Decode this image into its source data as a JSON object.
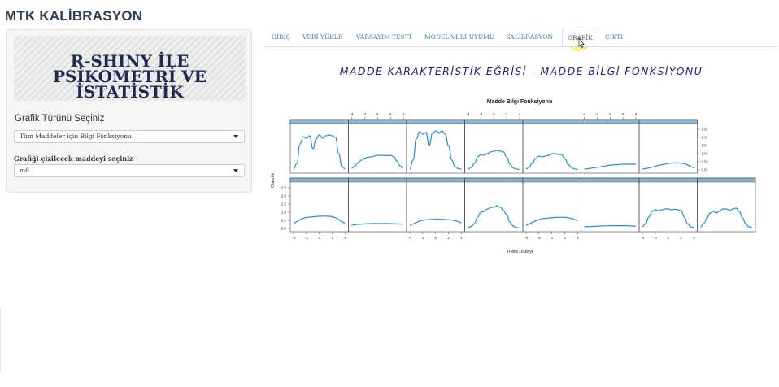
{
  "app": {
    "title": "MTK KALİBRASYON"
  },
  "sidebar": {
    "banner_lines": [
      "R-SHINY İLE PSİKOMETRİ VE",
      "İSTATİSTİK UYGULAMALARI"
    ],
    "chart_type_label": "Grafik Türünü Seçiniz",
    "chart_type_value": "Tüm Maddeler için Bilgi Fonksiyonu",
    "item_label": "Grafiği çizilecek maddeyi seçiniz",
    "item_value": "m6"
  },
  "tabs": [
    {
      "label": "GİRİŞ",
      "active": false
    },
    {
      "label": "VERİ YÜKLE",
      "active": false
    },
    {
      "label": "VARSAYIM TESTİ",
      "active": false
    },
    {
      "label": "MODEL VERİ UYUMU",
      "active": false
    },
    {
      "label": "KALİBRASYON",
      "active": false
    },
    {
      "label": "GRAFİK",
      "active": true
    },
    {
      "label": "ÇIKTI",
      "active": false
    }
  ],
  "main": {
    "heading": "MADDE KARAKTERİSTİK EĞRİSİ - MADDE BİLGİ FONKSİYONU"
  },
  "colors": {
    "curve": "#1f8fd6",
    "strip": "#8db6d6",
    "title": "#2c3e50",
    "heading": "#1c1e86"
  },
  "chart_data": {
    "type": "line",
    "title": "Madde Bilgi Fonksiyonu",
    "xlabel": "Theta Düzeyi",
    "ylabel": "Olasılık",
    "xlim": [
      -4,
      4
    ],
    "ylim": [
      0,
      2.7
    ],
    "xticks": [
      -4,
      -2,
      0,
      2,
      4
    ],
    "yticks": [
      0.0,
      0.5,
      1.0,
      1.5,
      2.0,
      2.5
    ],
    "x": [
      -4,
      -3.5,
      -3,
      -2.5,
      -2,
      -1.5,
      -1,
      -0.5,
      0,
      0.5,
      1,
      1.5,
      2,
      2.5,
      3,
      3.5,
      4
    ],
    "panels": [
      {
        "values": [
          0.05,
          0.4,
          1.6,
          2.05,
          1.95,
          2.1,
          1.3,
          1.9,
          2.15,
          1.95,
          2.1,
          2.15,
          2.1,
          2.0,
          1.0,
          0.2,
          0.05
        ]
      },
      {
        "values": [
          0.1,
          0.25,
          0.45,
          0.6,
          0.72,
          0.78,
          0.8,
          0.85,
          0.9,
          0.9,
          0.88,
          0.88,
          0.9,
          0.82,
          0.55,
          0.25,
          0.1
        ]
      },
      {
        "values": [
          0.05,
          0.6,
          1.9,
          2.35,
          2.2,
          2.3,
          1.5,
          2.25,
          2.4,
          2.3,
          2.4,
          2.2,
          1.5,
          0.6,
          0.2,
          0.08,
          0.05
        ]
      },
      {
        "values": [
          0.05,
          0.15,
          0.4,
          0.8,
          0.95,
          0.9,
          1.0,
          1.1,
          1.15,
          1.2,
          1.15,
          1.1,
          0.8,
          0.35,
          0.12,
          0.05,
          0.03
        ]
      },
      {
        "values": [
          0.05,
          0.2,
          0.45,
          0.7,
          0.85,
          0.8,
          0.85,
          0.9,
          1.0,
          1.0,
          0.95,
          0.95,
          0.7,
          0.35,
          0.15,
          0.06,
          0.03
        ]
      },
      {
        "values": [
          0.05,
          0.07,
          0.1,
          0.13,
          0.16,
          0.19,
          0.22,
          0.26,
          0.29,
          0.31,
          0.33,
          0.34,
          0.35,
          0.35,
          0.35,
          0.35,
          0.35
        ]
      },
      {
        "values": [
          0.05,
          0.08,
          0.12,
          0.17,
          0.22,
          0.27,
          0.32,
          0.36,
          0.4,
          0.42,
          0.43,
          0.43,
          0.42,
          0.38,
          0.3,
          0.2,
          0.12
        ]
      },
      {
        "values": [
          0.3,
          0.42,
          0.55,
          0.63,
          0.68,
          0.7,
          0.72,
          0.74,
          0.75,
          0.76,
          0.76,
          0.75,
          0.73,
          0.66,
          0.55,
          0.42,
          0.3
        ]
      },
      {
        "values": [
          0.2,
          0.23,
          0.25,
          0.27,
          0.28,
          0.29,
          0.3,
          0.3,
          0.3,
          0.3,
          0.3,
          0.3,
          0.3,
          0.29,
          0.28,
          0.27,
          0.26
        ]
      },
      {
        "values": [
          0.2,
          0.28,
          0.37,
          0.45,
          0.5,
          0.53,
          0.55,
          0.56,
          0.57,
          0.57,
          0.56,
          0.55,
          0.54,
          0.52,
          0.48,
          0.42,
          0.35
        ]
      },
      {
        "values": [
          0.05,
          0.12,
          0.3,
          0.7,
          1.0,
          1.05,
          1.2,
          1.3,
          1.3,
          1.4,
          1.3,
          1.1,
          0.85,
          0.4,
          0.15,
          0.06,
          0.03
        ]
      },
      {
        "values": [
          0.2,
          0.28,
          0.38,
          0.47,
          0.55,
          0.6,
          0.62,
          0.65,
          0.66,
          0.68,
          0.69,
          0.69,
          0.68,
          0.66,
          0.62,
          0.55,
          0.48
        ]
      },
      {
        "values": [
          0.1,
          0.11,
          0.12,
          0.13,
          0.14,
          0.15,
          0.16,
          0.16,
          0.17,
          0.17,
          0.17,
          0.17,
          0.17,
          0.17,
          0.16,
          0.15,
          0.14
        ]
      },
      {
        "values": [
          0.1,
          0.3,
          0.7,
          1.05,
          1.15,
          1.1,
          1.15,
          1.2,
          1.2,
          1.15,
          1.18,
          1.15,
          1.1,
          0.7,
          0.3,
          0.1,
          0.05
        ]
      },
      {
        "values": [
          0.1,
          0.3,
          0.65,
          0.95,
          1.05,
          0.95,
          1.1,
          1.2,
          1.2,
          1.1,
          1.2,
          1.25,
          1.05,
          0.65,
          0.3,
          0.1,
          0.05
        ]
      }
    ]
  }
}
